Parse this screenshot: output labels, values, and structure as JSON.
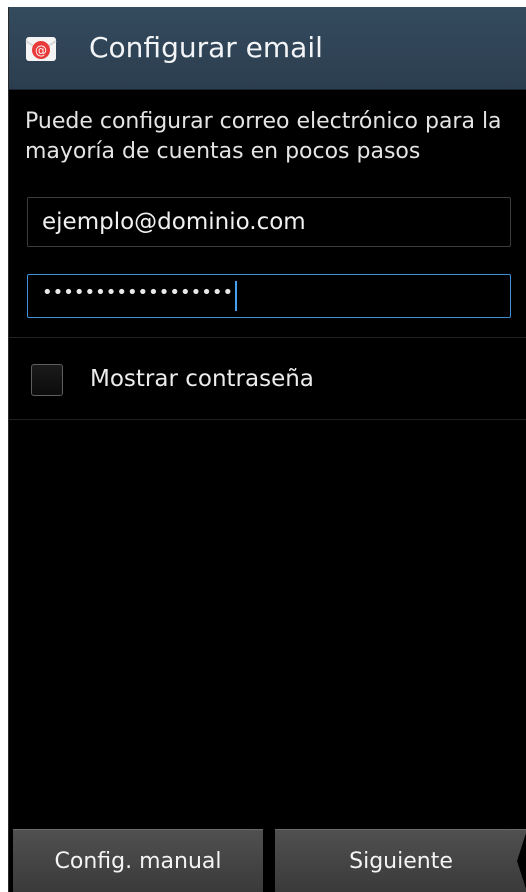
{
  "action_bar": {
    "title": "Configurar email",
    "icon": "email-app-icon",
    "background_color": "#344b5e"
  },
  "intro_text": "Puede configurar correo electrónico para la mayoría de cuentas en pocos pasos",
  "email_field": {
    "value": "ejemplo@dominio.com"
  },
  "password_field": {
    "masked_value": "••••••••••••••••••",
    "focused": true,
    "focus_color": "#3e8fd4"
  },
  "show_password": {
    "label": "Mostrar contraseña",
    "checked": false
  },
  "buttons": {
    "manual_label": "Config. manual",
    "next_label": "Siguiente"
  }
}
